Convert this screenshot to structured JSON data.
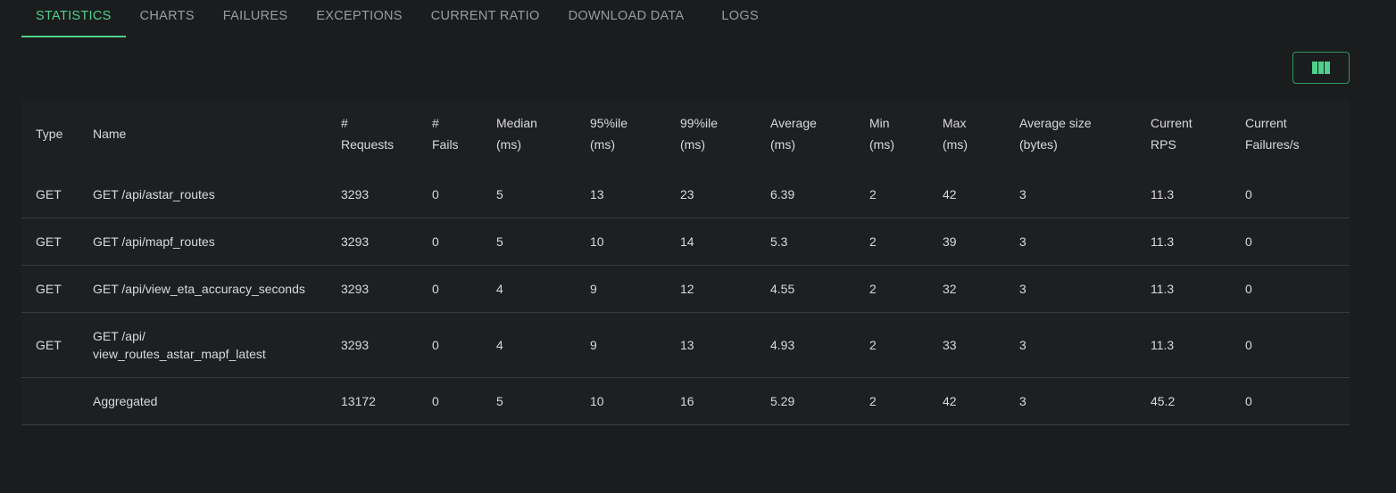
{
  "tabs": [
    {
      "label": "STATISTICS",
      "active": true
    },
    {
      "label": "CHARTS",
      "active": false
    },
    {
      "label": "FAILURES",
      "active": false
    },
    {
      "label": "EXCEPTIONS",
      "active": false
    },
    {
      "label": "CURRENT RATIO",
      "active": false
    },
    {
      "label": "DOWNLOAD DATA",
      "active": false
    },
    {
      "label": "LOGS",
      "active": false
    }
  ],
  "toolbar": {
    "columns_icon": "view-column-icon",
    "accent": "#4fd18b"
  },
  "table": {
    "headers": [
      [
        "Type",
        ""
      ],
      [
        "Name",
        ""
      ],
      [
        "#",
        "Requests"
      ],
      [
        "#",
        "Fails"
      ],
      [
        "Median",
        "(ms)"
      ],
      [
        "95%ile",
        "(ms)"
      ],
      [
        "99%ile",
        "(ms)"
      ],
      [
        "Average",
        "(ms)"
      ],
      [
        "Min",
        "(ms)"
      ],
      [
        "Max",
        "(ms)"
      ],
      [
        "Average size",
        "(bytes)"
      ],
      [
        "Current",
        "RPS"
      ],
      [
        "Current",
        "Failures/s"
      ]
    ],
    "rows": [
      [
        "GET",
        "GET /api/astar_routes",
        "3293",
        "0",
        "5",
        "13",
        "23",
        "6.39",
        "2",
        "42",
        "3",
        "11.3",
        "0"
      ],
      [
        "GET",
        "GET /api/mapf_routes",
        "3293",
        "0",
        "5",
        "10",
        "14",
        "5.3",
        "2",
        "39",
        "3",
        "11.3",
        "0"
      ],
      [
        "GET",
        "GET /api/view_eta_accuracy_seconds",
        "3293",
        "0",
        "4",
        "9",
        "12",
        "4.55",
        "2",
        "32",
        "3",
        "11.3",
        "0"
      ],
      [
        "GET",
        "GET /api/ view_routes_astar_mapf_latest",
        "3293",
        "0",
        "4",
        "9",
        "13",
        "4.93",
        "2",
        "33",
        "3",
        "11.3",
        "0"
      ],
      [
        "",
        "Aggregated",
        "13172",
        "0",
        "5",
        "10",
        "16",
        "5.29",
        "2",
        "42",
        "3",
        "45.2",
        "0"
      ]
    ]
  }
}
